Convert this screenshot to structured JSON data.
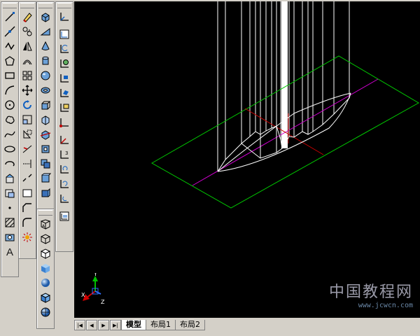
{
  "toolbars": {
    "draw": [
      "line",
      "construction-line",
      "polyline",
      "polygon",
      "rectangle",
      "arc",
      "circle",
      "revision-cloud",
      "spline",
      "ellipse",
      "ellipse-arc",
      "insert-block",
      "make-block",
      "point",
      "hatch",
      "region",
      "text"
    ],
    "modify": [
      "erase",
      "copy",
      "mirror",
      "offset",
      "array",
      "move",
      "rotate",
      "scale",
      "stretch",
      "trim",
      "extend",
      "break",
      "rectangle-frame",
      "chamfer",
      "fillet",
      "explode"
    ],
    "solids": [
      "box",
      "wedge",
      "cone",
      "cylinder",
      "sphere",
      "torus",
      "extrude",
      "revolve",
      "slice",
      "section",
      "interfere",
      "setup-drawing",
      "setup-view"
    ],
    "shade": [
      "2d-wireframe",
      "3d-wireframe",
      "hidden",
      "flat-shaded",
      "gouraud",
      "flat-edges",
      "gouraud-edges"
    ],
    "ucs": [
      "ucs",
      "named-ucs",
      "ucs-previous",
      "ucs-world",
      "ucs-object",
      "ucs-face",
      "ucs-view",
      "ucs-origin",
      "ucs-z-axis",
      "ucs-3point",
      "ucs-x",
      "ucs-y",
      "ucs-z",
      "ucs-apply"
    ]
  },
  "layout_tabs": {
    "model": "模型",
    "layout1": "布局1",
    "layout2": "布局2"
  },
  "ucs_icon": {
    "x": "X",
    "y": "Y",
    "z": "Z"
  },
  "watermark": {
    "text": "中国教程网",
    "url": "www.jcwcn.com"
  },
  "colors": {
    "viewport_bg": "#000000",
    "plane_edge": "#00c800",
    "axis_line": "#d000d0",
    "red_axis": "#c80000",
    "wire": "#ffffff"
  }
}
